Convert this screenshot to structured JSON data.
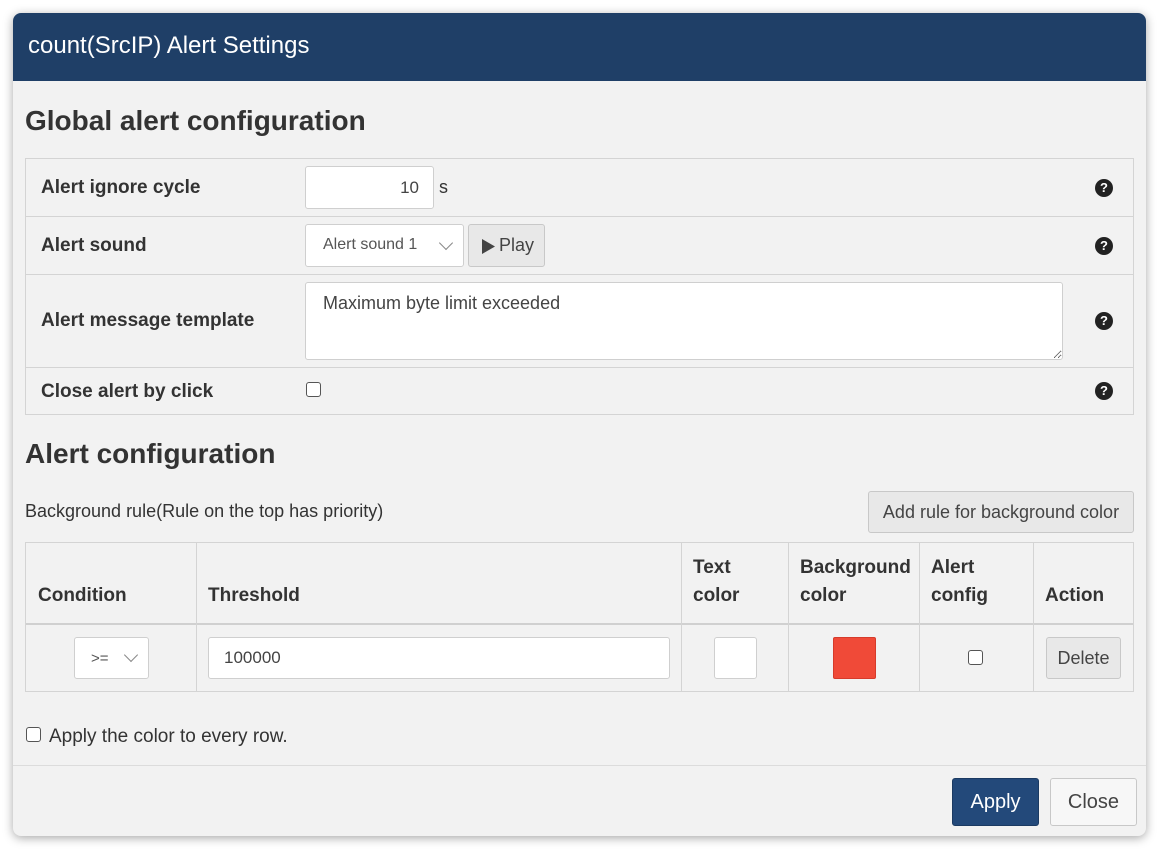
{
  "dialog": {
    "title": "count(SrcIP) Alert Settings"
  },
  "global": {
    "heading": "Global alert configuration",
    "ignore_cycle": {
      "label": "Alert ignore cycle",
      "value": "10",
      "unit": "s"
    },
    "sound": {
      "label": "Alert sound",
      "selected": "Alert sound 1",
      "play_label": "Play"
    },
    "message": {
      "label": "Alert message template",
      "value": "Maximum byte limit exceeded"
    },
    "close_by_click": {
      "label": "Close alert by click",
      "checked": false
    },
    "help_glyph": "?"
  },
  "alert": {
    "heading": "Alert configuration",
    "rule_caption": "Background rule(Rule on the top has priority)",
    "add_rule_label": "Add rule for background color",
    "columns": {
      "condition": "Condition",
      "threshold": "Threshold",
      "text_color": [
        "Text",
        "color"
      ],
      "background_color": [
        "Background",
        "color"
      ],
      "alert_config": [
        "Alert",
        "config"
      ],
      "action": "Action"
    },
    "rows": [
      {
        "condition": ">=",
        "threshold": "100000",
        "text_color": "#ffffff",
        "background_color": "#f04a38",
        "alert_config": false,
        "action": "Delete"
      }
    ],
    "apply_every_row_label": "Apply the color to every row."
  },
  "footer": {
    "apply_label": "Apply",
    "close_label": "Close"
  },
  "colors": {
    "header_bg": "#1f3f67",
    "apply_bg": "#23497a",
    "danger_swatch": "#f04a38"
  }
}
